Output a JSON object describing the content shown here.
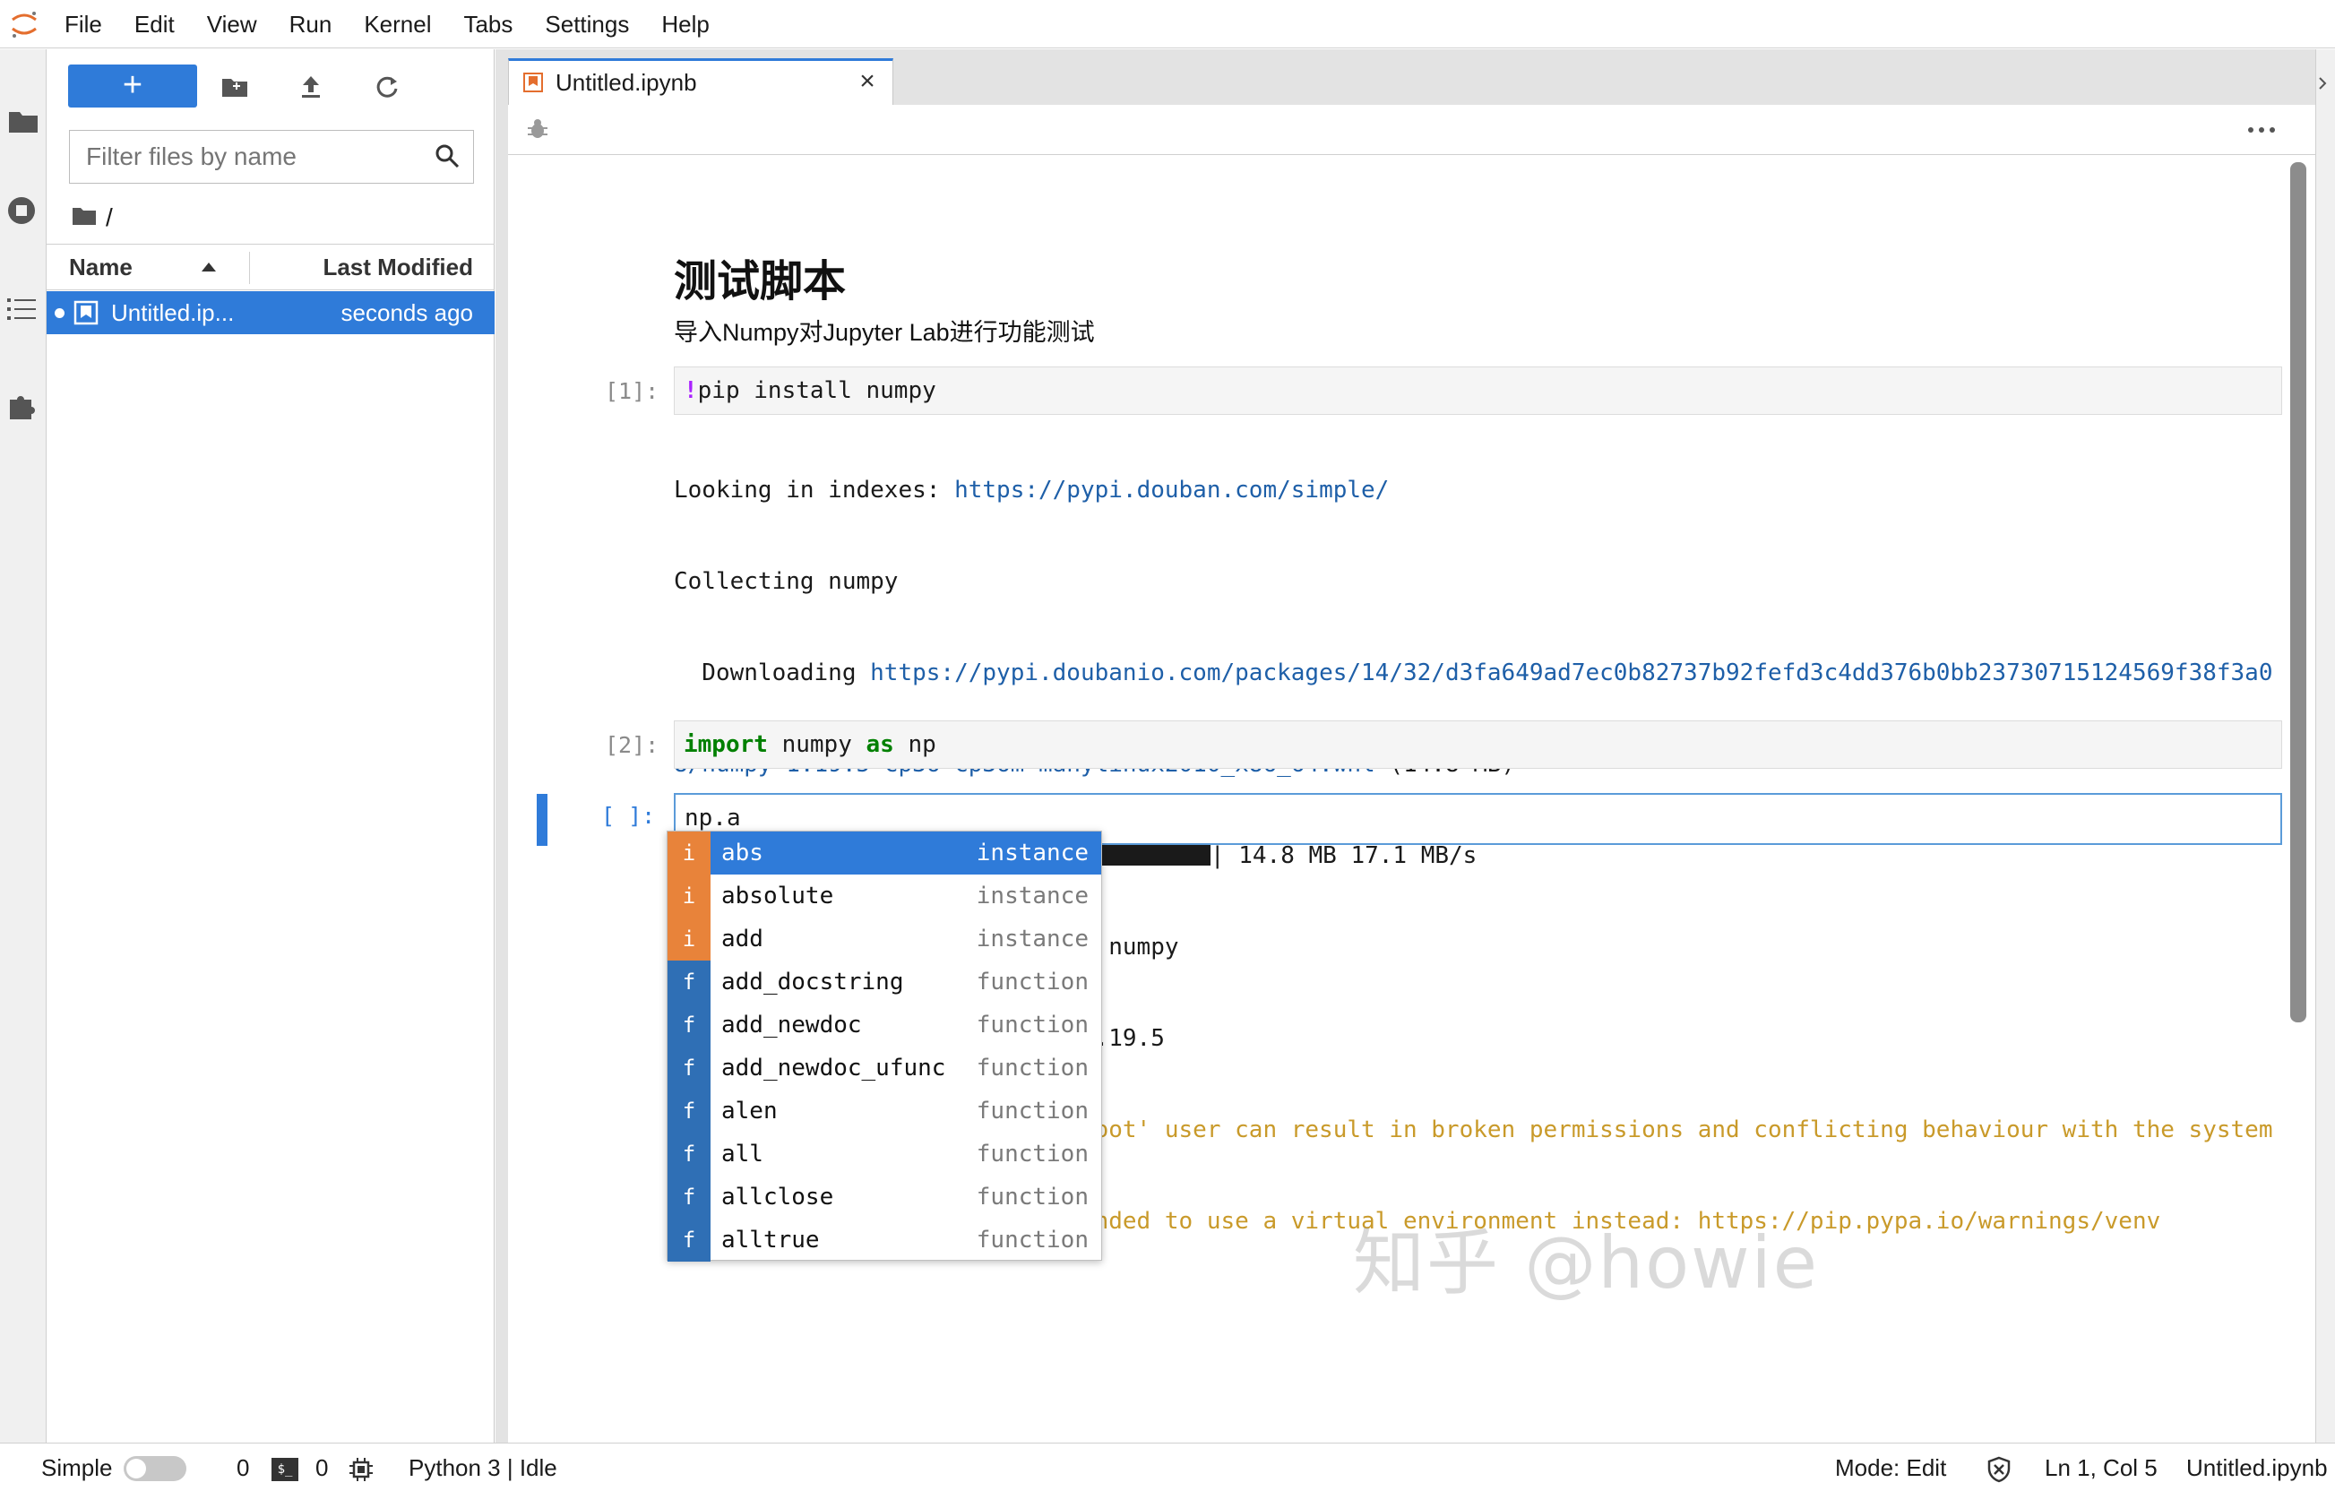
{
  "menubar": {
    "items": [
      "File",
      "Edit",
      "View",
      "Run",
      "Kernel",
      "Tabs",
      "Settings",
      "Help"
    ]
  },
  "filebrowser": {
    "new_button_label": "+",
    "filter_placeholder": "Filter files by name",
    "breadcrumb_path": "/",
    "columns": {
      "name": "Name",
      "modified": "Last Modified"
    },
    "files": [
      {
        "name": "Untitled.ip...",
        "modified": "seconds ago",
        "selected": true
      }
    ]
  },
  "tabs": [
    {
      "title": "Untitled.ipynb",
      "close": "×",
      "active": true
    }
  ],
  "notebook": {
    "markdown": {
      "heading": "测试脚本",
      "paragraph": "导入Numpy对Jupyter Lab进行功能测试"
    },
    "cells": [
      {
        "prompt": "[1]:",
        "input_bang": "!",
        "input_rest": "pip install numpy",
        "output": {
          "line1_text": "Looking in indexes: ",
          "line1_link": "https://pypi.douban.com/simple/",
          "line2": "Collecting numpy",
          "line3_text": "  Downloading ",
          "line3_link": "https://pypi.doubanio.com/packages/14/32/d3fa649ad7ec0b82737b92fefd3c4dd376b0bb23730715124569f38f3a0",
          "line4_link": "8/numpy-1.19.5-cp36-cp36m-manylinux2010_x86_64.whl",
          "line4_text": " (14.8 MB)",
          "line5_prefix": "     |",
          "line5_suffix": "| 14.8 MB 17.1 MB/s",
          "progress": 1.0,
          "line6": "Installing collected packages: numpy",
          "line7": "Successfully installed numpy-1.19.5",
          "warning1": "WARNING: Running pip as the 'root' user can result in broken permissions and conflicting behaviour with the system",
          "warning2": "package manager. It is recommended to use a virtual environment instead: https://pip.pypa.io/warnings/venv"
        }
      },
      {
        "prompt": "[2]:",
        "kw1": "import",
        "mid": " numpy ",
        "kw2": "as",
        "end": " np"
      },
      {
        "prompt": "[ ]:",
        "input": "np.a"
      }
    ]
  },
  "completer": {
    "items": [
      {
        "badge": "i",
        "label": "abs",
        "type": "instance",
        "active": true
      },
      {
        "badge": "i",
        "label": "absolute",
        "type": "instance"
      },
      {
        "badge": "i",
        "label": "add",
        "type": "instance"
      },
      {
        "badge": "f",
        "label": "add_docstring",
        "type": "function"
      },
      {
        "badge": "f",
        "label": "add_newdoc",
        "type": "function"
      },
      {
        "badge": "f",
        "label": "add_newdoc_ufunc",
        "type": "function"
      },
      {
        "badge": "f",
        "label": "alen",
        "type": "function"
      },
      {
        "badge": "f",
        "label": "all",
        "type": "function"
      },
      {
        "badge": "f",
        "label": "allclose",
        "type": "function"
      },
      {
        "badge": "f",
        "label": "alltrue",
        "type": "function"
      }
    ]
  },
  "watermark": "知乎 @howie",
  "statusbar": {
    "simple_label": "Simple",
    "terminals_count": "0",
    "kernels_count": "0",
    "kernel_status": "Python 3 | Idle",
    "mode": "Mode: Edit",
    "cursor": "Ln 1, Col 5",
    "filename": "Untitled.ipynb"
  },
  "colors": {
    "accent": "#2f7bd9",
    "instance_badge": "#e8833a",
    "function_badge": "#2f6fb5",
    "link": "#1e5fa8",
    "warning": "#c99a2a",
    "keyword": "#008000"
  }
}
